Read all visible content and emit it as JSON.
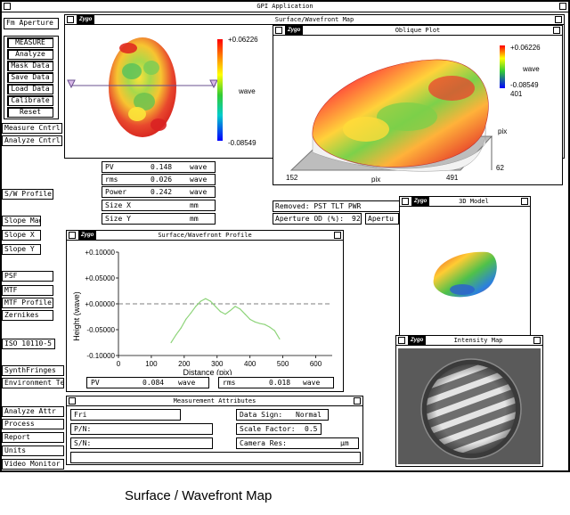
{
  "app": {
    "title": "GPI Application"
  },
  "sidebar": {
    "aperture_button": "Fm Aperture",
    "main_group": [
      "MEASURE",
      "Analyze",
      "Mask Data",
      "Save Data",
      "Load Data",
      "Calibrate",
      "Reset"
    ],
    "controls": [
      "Measure Cntrl",
      "Analyze Cntrl"
    ],
    "profile": [
      "S/W Profile"
    ],
    "slope": [
      "Slope Mag",
      "Slope X",
      "Slope Y"
    ],
    "optics": [
      "PSF",
      "MTF",
      "MTF Profile",
      "Zernikes"
    ],
    "iso": [
      "ISO 10110-5"
    ],
    "synth": [
      "SynthFringes",
      "Environment Te"
    ],
    "bottom": [
      "Analyze Attr",
      "Process",
      "Report",
      "Units",
      "Video Monitor"
    ]
  },
  "surface_map": {
    "title": "Surface/Wavefront Map",
    "scale_max": "+0.06226",
    "scale_min": "-0.08549",
    "scale_unit": "wave"
  },
  "oblique": {
    "title": "Oblique Plot",
    "scale_max": "+0.06226",
    "scale_unit": "wave",
    "scale_min": "-0.08549",
    "y_top": "401",
    "y_label": "pix",
    "y_bottom": "62",
    "x_left": "152",
    "x_label": "pix",
    "x_right": "491"
  },
  "stats": [
    {
      "label": "PV",
      "value": "0.148",
      "unit": "wave"
    },
    {
      "label": "rms",
      "value": "0.026",
      "unit": "wave"
    },
    {
      "label": "Power",
      "value": "0.242",
      "unit": "wave"
    },
    {
      "label": "Size X",
      "value": "",
      "unit": "mm"
    },
    {
      "label": "Size Y",
      "value": "",
      "unit": "mm"
    }
  ],
  "removed": {
    "text": "Removed: PST TLT PWR"
  },
  "aperture": {
    "label": "Aperture OD (%):",
    "value": "92",
    "extra": "Apertu"
  },
  "model_3d": {
    "title": "3D Model"
  },
  "intensity": {
    "title": "Intensity Map"
  },
  "profile": {
    "title": "Surface/Wavefront Profile",
    "pv_label": "PV",
    "pv_value": "0.084",
    "pv_unit": "wave",
    "rms_label": "rms",
    "rms_value": "0.018",
    "rms_unit": "wave"
  },
  "chart_data": {
    "type": "line",
    "xlabel": "Distance (pix)",
    "ylabel": "Height (wave)",
    "xlim": [
      0,
      650
    ],
    "ylim": [
      -0.1,
      0.1
    ],
    "x_ticks": [
      "0",
      "100",
      "200",
      "300",
      "400",
      "500",
      "600"
    ],
    "y_ticks": [
      "+0.10000",
      "+0.05000",
      "+0.00000",
      "-0.05000",
      "-0.10000"
    ],
    "series": [
      {
        "color": "#8ed47a",
        "x": [
          160,
          175,
          190,
          205,
          220,
          235,
          250,
          265,
          280,
          295,
          310,
          325,
          340,
          355,
          370,
          385,
          400,
          415,
          430,
          445,
          460,
          475,
          490
        ],
        "y": [
          -0.075,
          -0.06,
          -0.047,
          -0.03,
          -0.018,
          -0.005,
          0.005,
          0.01,
          0.005,
          -0.005,
          -0.015,
          -0.02,
          -0.013,
          -0.005,
          -0.01,
          -0.02,
          -0.03,
          -0.035,
          -0.038,
          -0.04,
          -0.045,
          -0.052,
          -0.068
        ]
      }
    ],
    "reference_line": 0.0
  },
  "attributes": {
    "title": "Measurement Attributes",
    "date_value": "Fri",
    "pn_label": "P/N:",
    "sn_label": "S/N:",
    "data_sign_label": "Data Sign:",
    "data_sign_value": "Normal",
    "scale_factor_label": "Scale Factor:",
    "scale_factor_value": "0.5",
    "camera_res_label": "Camera Res:",
    "camera_res_unit": "µm"
  },
  "caption": "Surface / Wavefront Map",
  "logo_text": "Zygo"
}
